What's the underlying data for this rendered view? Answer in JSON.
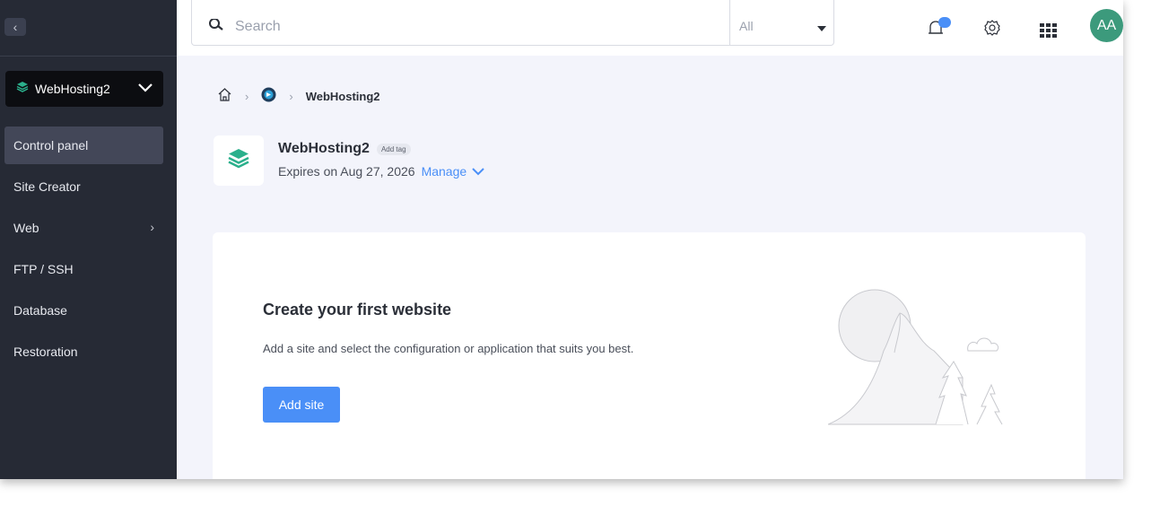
{
  "topbar": {
    "search_placeholder": "Search",
    "scope_value": "All",
    "avatar_initials": "AA"
  },
  "sidebar": {
    "product_name": "WebHosting2",
    "items": [
      {
        "label": "Control panel",
        "active": true
      },
      {
        "label": "Site Creator"
      },
      {
        "label": "Web",
        "has_submenu": true
      },
      {
        "label": "FTP / SSH"
      },
      {
        "label": "Database"
      },
      {
        "label": "Restoration"
      }
    ]
  },
  "breadcrumb": {
    "current": "WebHosting2"
  },
  "product": {
    "title": "WebHosting2",
    "tag_label": "Add tag",
    "expires": "Expires on Aug 27, 2026",
    "manage_label": "Manage"
  },
  "empty_state": {
    "title": "Create your first website",
    "description": "Add a site and select the configuration or application that suits you best.",
    "button_label": "Add site"
  },
  "colors": {
    "accent": "#4a8ff7",
    "sidebar_bg": "#262a35",
    "avatar_bg": "#3c9a7c",
    "product_icon": "#2bb08c"
  }
}
